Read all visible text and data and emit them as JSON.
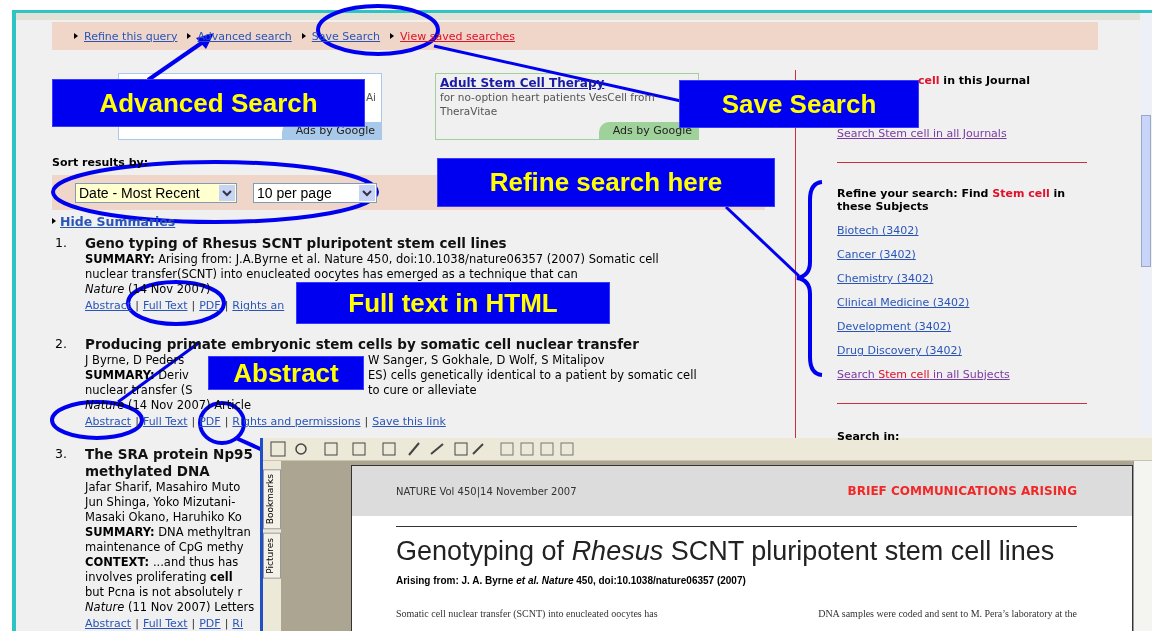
{
  "top_links": [
    {
      "label": "Refine this query",
      "highlight": false
    },
    {
      "label": "Advanced search",
      "highlight": false
    },
    {
      "label": "Save Search",
      "highlight": false
    },
    {
      "label": "View saved searches",
      "highlight": true
    }
  ],
  "ads": [
    {
      "text": "Ai",
      "badge": "Ads by Google",
      "color": "#a9c9ea"
    },
    {
      "title": "Adult Stem Cell Therapy",
      "text": "for no-option heart patients VesCell from TheraVitae",
      "badge": "Ads by Google",
      "color": "#9fd29a"
    }
  ],
  "sort": {
    "label": "Sort results by:",
    "order": "Date - Most Recent",
    "per_page": "10 per page"
  },
  "summaries_toggle": "Hide Summaries",
  "link_separator": "|",
  "results": [
    {
      "number": "1.",
      "title_lines": [
        "Geno typing of Rhesus SCNT pluripotent stem cell lines"
      ],
      "lines": [
        [
          "**SUMMARY:** Arising from: J.A.Byrne et al. Nature 450, doi:10.1038/nature06357 (2007) Somatic cell"
        ],
        [
          "nuclear transfer(SCNT) into enucleated oocytes has emerged as a technique that can"
        ],
        [
          "*Nature* (14 Nov 2007)"
        ]
      ],
      "links": [
        "Abstract",
        "Full Text",
        "PDF",
        "Rights an"
      ],
      "callout": "Full text in HTML"
    },
    {
      "number": "2.",
      "title_lines": [
        "Producing primate embryonic stem cells by somatic cell nuclear transfer"
      ],
      "lines": [
        [
          "J Byrne, D Peders",
          "W Sanger, S Gokhale, D Wolf, S Mitalipov"
        ],
        [
          "**SUMMARY:** Deriv",
          "ES) cells genetically identical to a patient by somatic cell"
        ],
        [
          "nuclear transfer (S",
          "to cure or alleviate"
        ],
        [
          "*Nature* (14 Nov 2007) Article"
        ]
      ],
      "links": [
        "Abstract",
        "Full Text",
        "PDF",
        "Rights and permissions",
        "Save this link"
      ],
      "callout": "Abstract"
    },
    {
      "number": "3.",
      "title_lines": [
        "The SRA protein Np95",
        "methylated DNA"
      ],
      "lines": [
        [
          "Jafar Sharif, Masahiro Muto"
        ],
        [
          "Jun Shinga, Yoko Mizutani-"
        ],
        [
          "Masaki Okano, Haruhiko Ko"
        ],
        [
          "**SUMMARY:** DNA methyltran"
        ],
        [
          "maintenance of CpG methy"
        ],
        [
          "**CONTEXT:** ...and thus has"
        ],
        [
          "involves proliferating **cell**"
        ],
        [
          "but Pcna is not absolutely r"
        ],
        [
          "*Nature* (11 Nov 2007) Letters"
        ]
      ],
      "links": [
        "Abstract",
        "Full Text",
        "PDF",
        "Ri"
      ]
    }
  ],
  "sidebar": {
    "journal_heading": [
      {
        "text": "cell",
        "highlight": true
      },
      {
        "text": " in this Journal",
        "highlight": false
      }
    ],
    "all_journals_link": "Search Stem cell in all Journals",
    "refine_heading": [
      {
        "text": "Refine your search: Find ",
        "highlight": false
      },
      {
        "text": "Stem cell",
        "highlight": true
      },
      {
        "text": " in these Subjects",
        "highlight": false
      }
    ],
    "subjects": [
      "Biotech (3402)",
      "Cancer (3402)",
      "Chemistry (3402)",
      "Clinical Medicine (3402)",
      "Development (3402)",
      "Drug Discovery (3402)"
    ],
    "all_subjects_link": [
      {
        "text": "Search ",
        "highlight": false
      },
      {
        "text": "Stem cell",
        "highlight": true
      },
      {
        "text": " in all Subjects",
        "highlight": false
      }
    ],
    "search_in": "Search in:"
  },
  "callouts": [
    {
      "label": "Advanced Search"
    },
    {
      "label": "Save Search"
    },
    {
      "label": "Refine search here"
    }
  ],
  "pdf_viewer": {
    "tabs": [
      "Bookmarks",
      "Pictures"
    ],
    "header_left": "NATURE Vol 450|14 November 2007",
    "header_right": "BRIEF COMMUNICATIONS ARISING",
    "title": "Genotyping of *Rhesus* SCNT pluripotent stem cell lines",
    "byline": "Arising from: J. A. Byrne *et al.* *Nature* 450, doi:10.1038/nature06357 (2007)",
    "columns": [
      "Somatic cell nuclear transfer (SCNT) into enucleated oocytes has",
      "DNA samples were coded and sent to M. Pera’s laboratory at the"
    ]
  }
}
